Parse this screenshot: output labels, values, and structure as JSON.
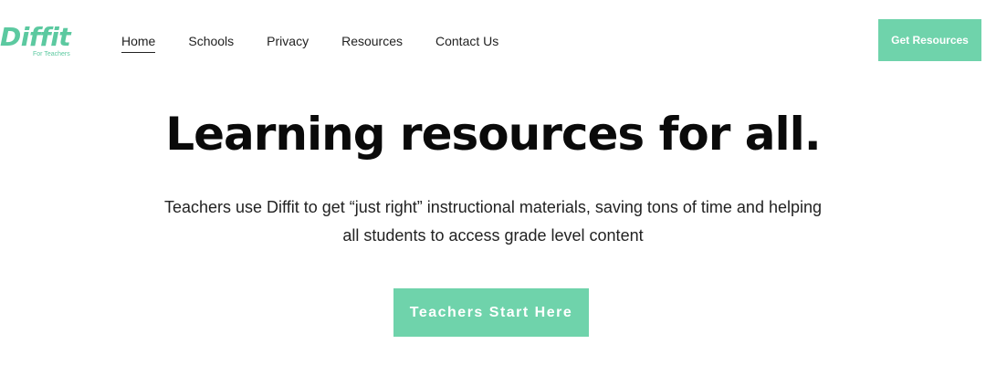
{
  "brand": {
    "name": "Diffit",
    "tagline": "For Teachers",
    "color": "#5cc9a0"
  },
  "nav": {
    "items": [
      {
        "label": "Home",
        "active": true
      },
      {
        "label": "Schools",
        "active": false
      },
      {
        "label": "Privacy",
        "active": false
      },
      {
        "label": "Resources",
        "active": false
      },
      {
        "label": "Contact Us",
        "active": false
      }
    ]
  },
  "header": {
    "cta_label": "Get Resources"
  },
  "hero": {
    "title": "Learning resources for all.",
    "subtitle": "Teachers use Diffit to get “just right” instructional materials, saving tons of time and helping all students to access grade level content",
    "cta_label": "Teachers Start Here"
  },
  "colors": {
    "accent": "#6fd3ab",
    "text": "#0a0a0a",
    "background": "#ffffff"
  }
}
